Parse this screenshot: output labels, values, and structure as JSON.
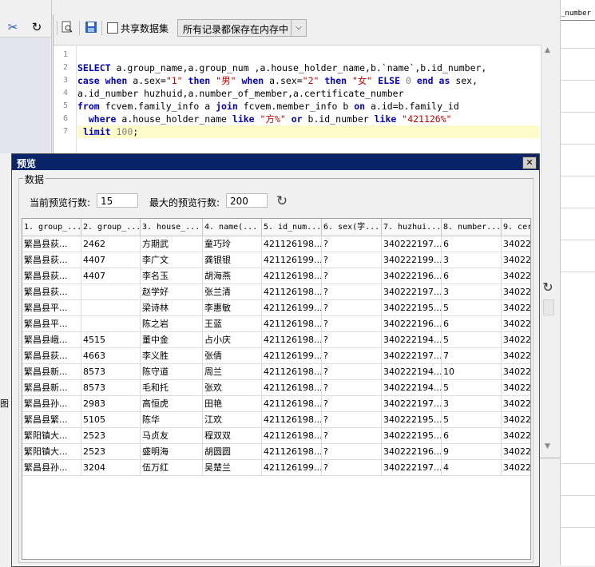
{
  "left_panel": {
    "toolbar_icons": [
      "scissors-icon",
      "redo-icon"
    ],
    "tail_text": "图"
  },
  "editor": {
    "toolbar": {
      "icons": [
        "search-doc-icon",
        "save-icon"
      ],
      "share_checkbox_label": "共享数据集",
      "share_checked": false,
      "storage_mode": "所有记录都保存在内存中"
    },
    "line_numbers": [
      "1",
      "2",
      "3",
      "4",
      "5",
      "6",
      "7"
    ],
    "code_lines": [
      "",
      "SELECT a.group_name,a.group_num ,a.house_holder_name,b.`name`,b.id_number,",
      "case when a.sex=\"1\" then \"男\" when a.sex=\"2\" then \"女\" ELSE 0 end as sex,",
      "a.id_number huzhuid,a.number_of_member,a.certificate_number",
      "from fcvem.family_info a join fcvem.member_info b on a.id=b.family_id",
      "  where a.house_holder_name like \"方%\" or b.id_number like \"421126%\"",
      " limit 100;"
    ]
  },
  "right_panel": {
    "header_text": "_number"
  },
  "dialog": {
    "title": "预览",
    "close_symbol": "✕",
    "group_title": "数据",
    "current_rows_label": "当前预览行数:",
    "current_rows_value": "15",
    "max_rows_label": "最大的预览行数:",
    "max_rows_value": "200",
    "columns": [
      "1. group_...",
      "2. group_...",
      "3. house_...",
      "4. name(...",
      "5. id_num...",
      "6. sex(字...",
      "7. huzhui...",
      "8. number...",
      "9. cer"
    ],
    "rows": [
      [
        "繁昌县荻...",
        "2462",
        "方期武",
        "童巧玲",
        "421126198...",
        "?",
        "340222197...",
        "6",
        "34022"
      ],
      [
        "繁昌县荻...",
        "4407",
        "李广文",
        "龚银银",
        "421126199...",
        "?",
        "340222199...",
        "3",
        "34022"
      ],
      [
        "繁昌县荻...",
        "4407",
        "李名玉",
        "胡海燕",
        "421126198...",
        "?",
        "340222196...",
        "6",
        "34022"
      ],
      [
        "繁昌县荻...",
        "",
        "赵学好",
        "张兰清",
        "421126198...",
        "?",
        "340222197...",
        "3",
        "34022"
      ],
      [
        "繁昌县平...",
        "",
        "梁诗林",
        "李惠敏",
        "421126199...",
        "?",
        "340222195...",
        "5",
        "34022"
      ],
      [
        "繁昌县平...",
        "",
        "陈之岩",
        "王蓝",
        "421126198...",
        "?",
        "340222196...",
        "6",
        "34022"
      ],
      [
        "繁昌县峨...",
        "4515",
        "董中金",
        "占小庆",
        "421126198...",
        "?",
        "340222194...",
        "5",
        "34022"
      ],
      [
        "繁昌县荻...",
        "4663",
        "李义胜",
        "张倩",
        "421126199...",
        "?",
        "340222197...",
        "7",
        "34022"
      ],
      [
        "繁昌县新...",
        "8573",
        "陈守道",
        "周兰",
        "421126198...",
        "?",
        "340222194...",
        "10",
        "34022"
      ],
      [
        "繁昌县新...",
        "8573",
        "毛和托",
        "张欢",
        "421126198...",
        "?",
        "340222194...",
        "5",
        "34022"
      ],
      [
        "繁昌县孙...",
        "2983",
        "高恒虎",
        "田艳",
        "421126198...",
        "?",
        "340222197...",
        "3",
        "34022"
      ],
      [
        "繁昌县繁...",
        "5105",
        "陈华",
        "江欢",
        "421126198...",
        "?",
        "340222195...",
        "5",
        "34022"
      ],
      [
        "繁阳镇大...",
        "2523",
        "马贞友",
        "程双双",
        "421126198...",
        "?",
        "340222195...",
        "6",
        "34022"
      ],
      [
        "繁阳镇大...",
        "2523",
        "盛明海",
        "胡圆圆",
        "421126198...",
        "?",
        "340222196...",
        "9",
        "34022"
      ],
      [
        "繁昌县孙...",
        "3204",
        "伍万红",
        "吴楚兰",
        "421126199...",
        "?",
        "340222197...",
        "4",
        "34022"
      ]
    ]
  }
}
